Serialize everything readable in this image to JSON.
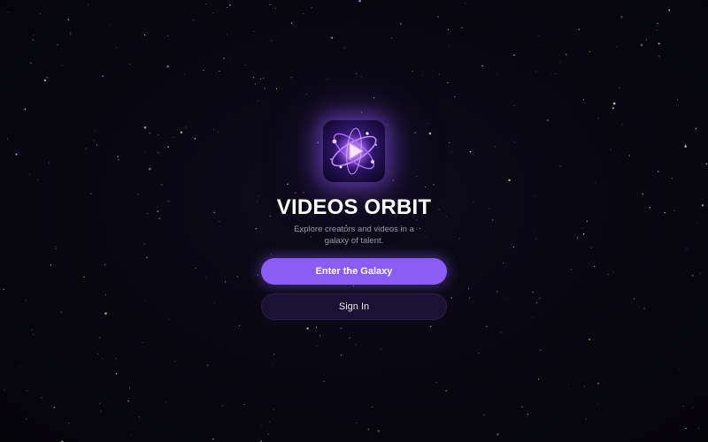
{
  "app": {
    "title": "VIDEOS ORBIT",
    "tagline": "Explore creators and videos in a galaxy of talent.",
    "logo_icon": "orbit-play-logo-icon"
  },
  "actions": {
    "primary_label": "Enter the Galaxy",
    "secondary_label": "Sign In"
  },
  "colors": {
    "background": "#08070f",
    "accent": "#8a5cf6",
    "secondary_button": "#1a1230",
    "title": "#ffffff",
    "tagline": "#9c98ad"
  }
}
